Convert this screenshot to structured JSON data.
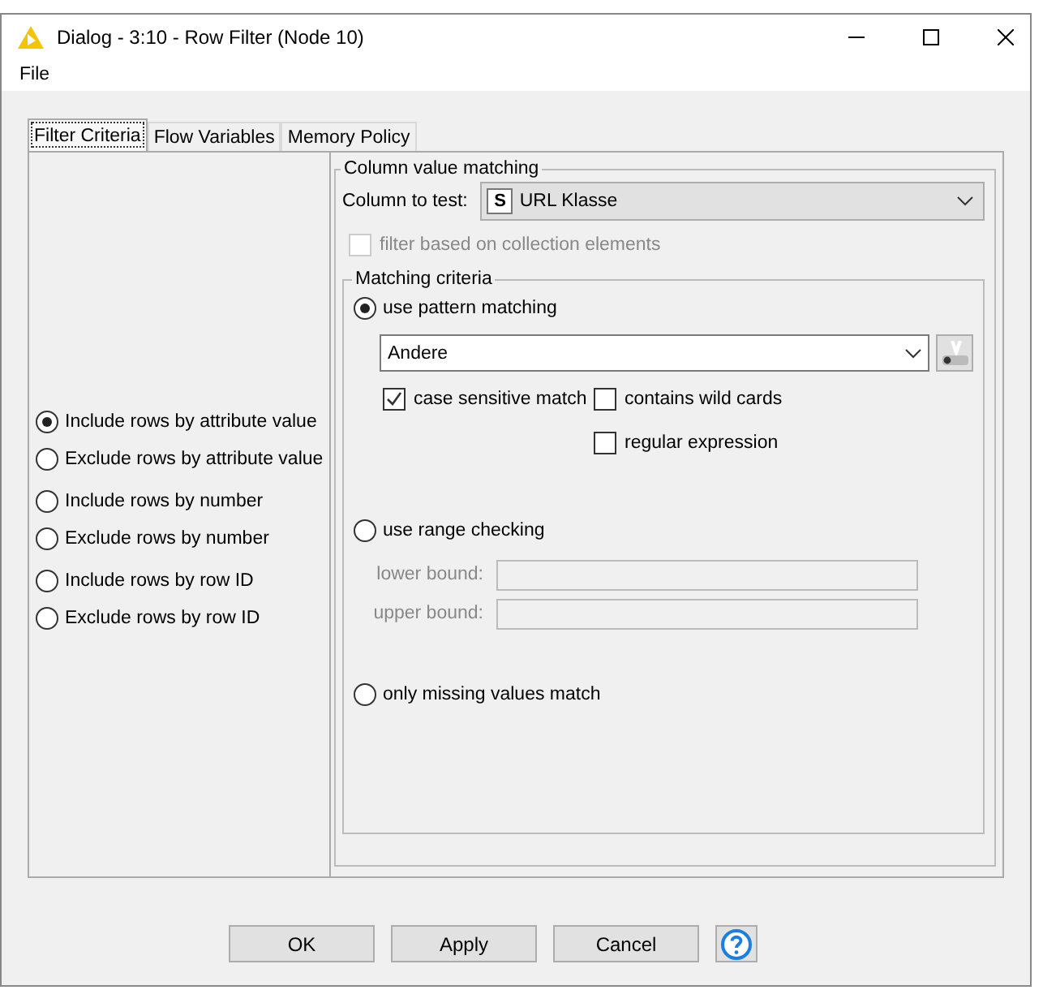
{
  "window": {
    "title": "Dialog - 3:10 - Row Filter (Node 10)"
  },
  "menu": [
    "File"
  ],
  "tabs": [
    {
      "label": "Filter Criteria",
      "selected": true
    },
    {
      "label": "Flow Variables",
      "selected": false
    },
    {
      "label": "Memory Policy",
      "selected": false
    }
  ],
  "filter_modes": [
    {
      "label": "Include rows by attribute value",
      "selected": true
    },
    {
      "label": "Exclude rows by attribute value",
      "selected": false
    },
    {
      "label": "Include rows by number",
      "selected": false
    },
    {
      "label": "Exclude rows by number",
      "selected": false
    },
    {
      "label": "Include rows by row ID",
      "selected": false
    },
    {
      "label": "Exclude rows by row ID",
      "selected": false
    }
  ],
  "column_value_matching": {
    "title": "Column value matching",
    "column_label": "Column to test:",
    "column_type": "S",
    "column_value": "URL Klasse",
    "collection_filter": {
      "label": "filter based on collection elements",
      "checked": false,
      "disabled": true
    },
    "matching_criteria": {
      "title": "Matching criteria",
      "options": [
        {
          "kind": "pattern",
          "label": "use pattern matching",
          "selected": true,
          "value": "Andere",
          "checkboxes": [
            {
              "label": "case sensitive match",
              "checked": true
            },
            {
              "label": "contains wild cards",
              "checked": false
            },
            {
              "label": "regular expression",
              "checked": false
            }
          ]
        },
        {
          "kind": "range",
          "label": "use range checking",
          "selected": false,
          "bounds": [
            {
              "label": "lower bound:",
              "disabled": true
            },
            {
              "label": "upper bound:",
              "disabled": true
            }
          ]
        },
        {
          "kind": "missing",
          "label": "only missing values match",
          "selected": false
        }
      ]
    }
  },
  "buttons": [
    "OK",
    "Apply",
    "Cancel"
  ]
}
